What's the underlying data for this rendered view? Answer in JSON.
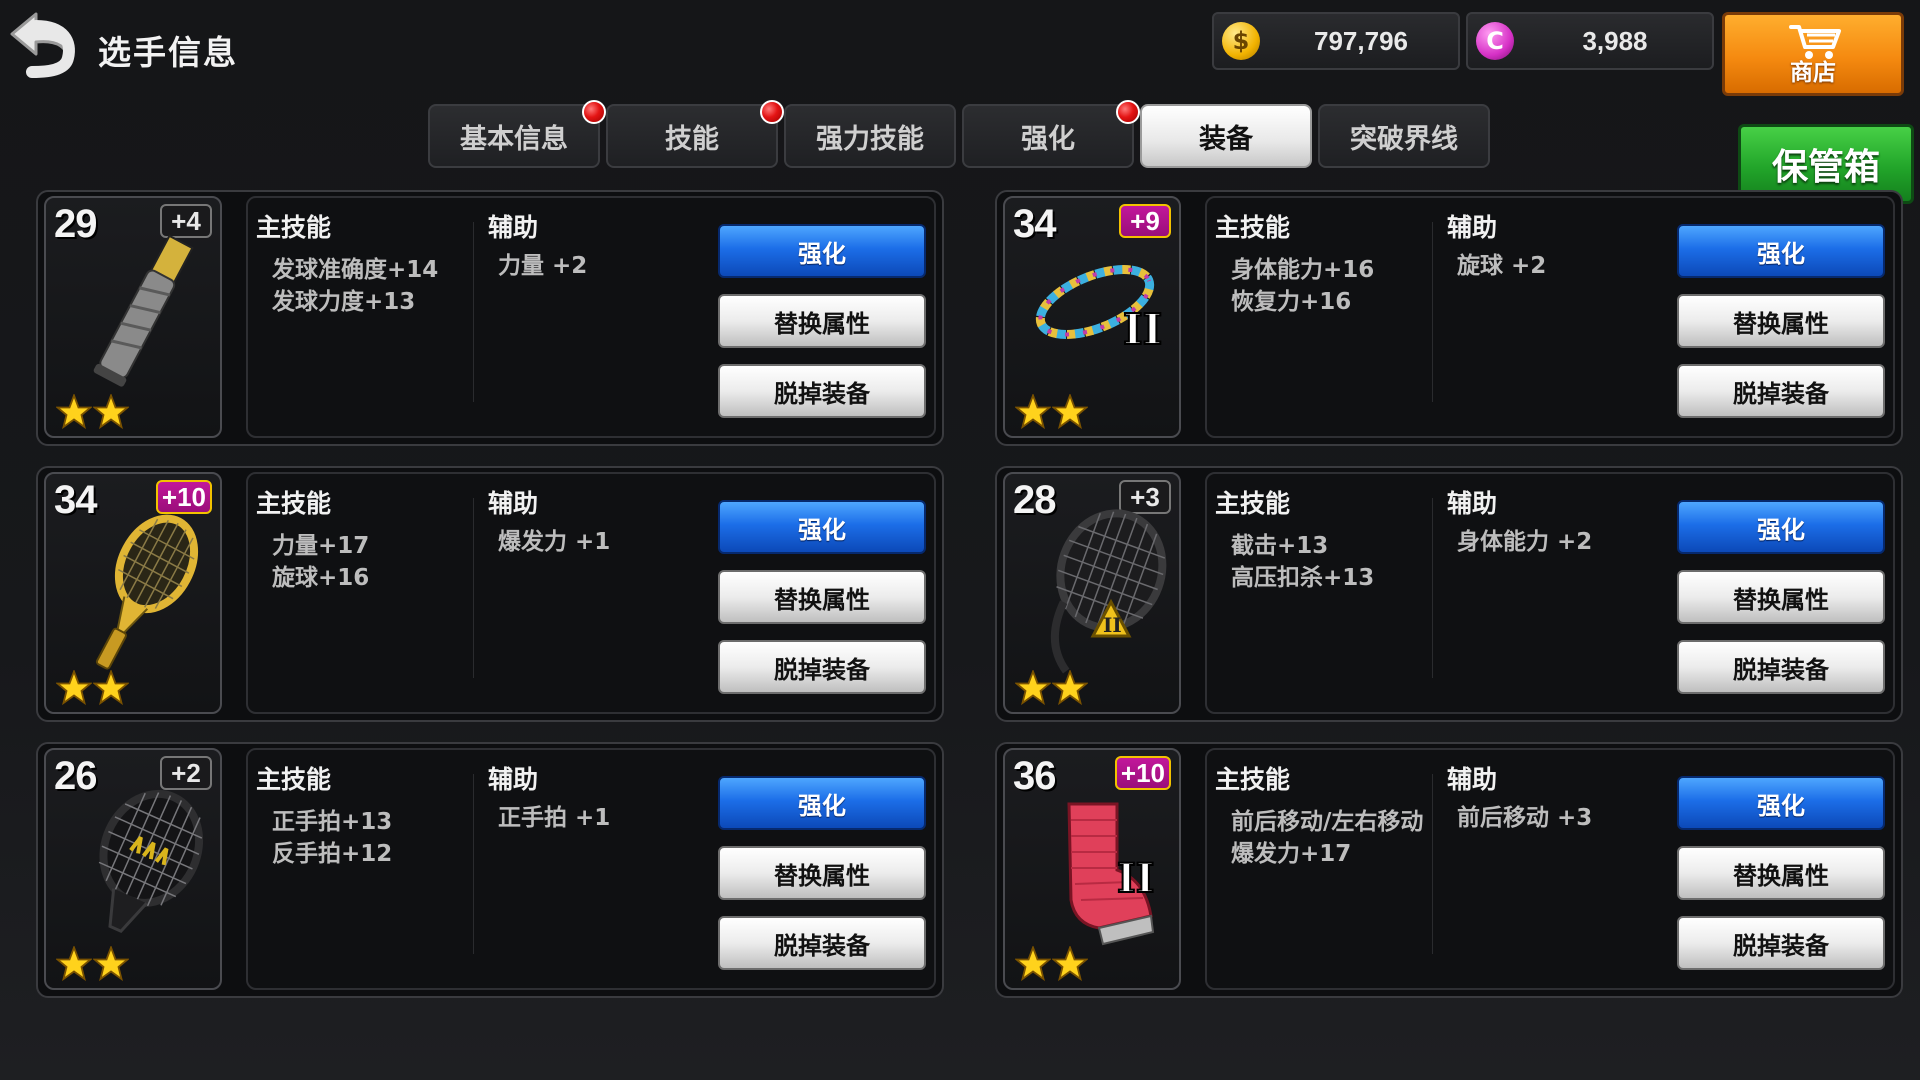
{
  "header": {
    "title": "选手信息",
    "gold_amount": "797,796",
    "gem_amount": "3,988",
    "shop_label": "商店",
    "storage_label": "保管箱",
    "gold_coin_glyph": "$",
    "gem_coin_glyph": "C"
  },
  "tabs": [
    {
      "label": "基本信息",
      "notification": true,
      "active": false
    },
    {
      "label": "技能",
      "notification": true,
      "active": false
    },
    {
      "label": "强力技能",
      "notification": false,
      "active": false
    },
    {
      "label": "强化",
      "notification": true,
      "active": false
    },
    {
      "label": "装备",
      "notification": false,
      "active": true
    },
    {
      "label": "突破界线",
      "notification": false,
      "active": false
    }
  ],
  "colors": {
    "shop": "#f58a10",
    "storage": "#22a52a",
    "enhance_button": "#1c6ee8",
    "notification_dot": "#e41414",
    "plus_badge_high": "#9a0e7a"
  },
  "labels": {
    "main_skill": "主技能",
    "sub_skill": "辅助",
    "enhance": "强化",
    "replace": "替换属性",
    "unequip": "脱掉装备"
  },
  "equipment": [
    {
      "level": "29",
      "plus": "+4",
      "plus_gold": false,
      "stars": 2,
      "icon": "racket-grip-icon",
      "main_stats": [
        "发球准确度+14",
        "发球力度+13"
      ],
      "sub_stats": [
        "力量 +2"
      ]
    },
    {
      "level": "34",
      "plus": "+9",
      "plus_gold": true,
      "stars": 2,
      "icon": "bracelet-icon",
      "tier": "II",
      "main_stats": [
        "身体能力+16",
        "恢复力+16"
      ],
      "sub_stats": [
        "旋球 +2"
      ]
    },
    {
      "level": "34",
      "plus": "+10",
      "plus_gold": true,
      "stars": 2,
      "icon": "gold-racket-icon",
      "main_stats": [
        "力量+17",
        "旋球+16"
      ],
      "sub_stats": [
        "爆发力 +1"
      ]
    },
    {
      "level": "28",
      "plus": "+3",
      "plus_gold": false,
      "stars": 2,
      "icon": "dampener-racket-icon",
      "tier": "II",
      "main_stats": [
        "截击+13",
        "高压扣杀+13"
      ],
      "sub_stats": [
        "身体能力 +2"
      ]
    },
    {
      "level": "26",
      "plus": "+2",
      "plus_gold": false,
      "stars": 2,
      "icon": "string-racket-icon",
      "main_stats": [
        "正手拍+13",
        "反手拍+12"
      ],
      "sub_stats": [
        "正手拍 +1"
      ]
    },
    {
      "level": "36",
      "plus": "+10",
      "plus_gold": true,
      "stars": 2,
      "icon": "ankle-brace-icon",
      "tier": "II",
      "main_stats": [
        "前后移动/左右移动",
        "爆发力+17"
      ],
      "sub_stats": [
        "前后移动 +3"
      ]
    }
  ]
}
